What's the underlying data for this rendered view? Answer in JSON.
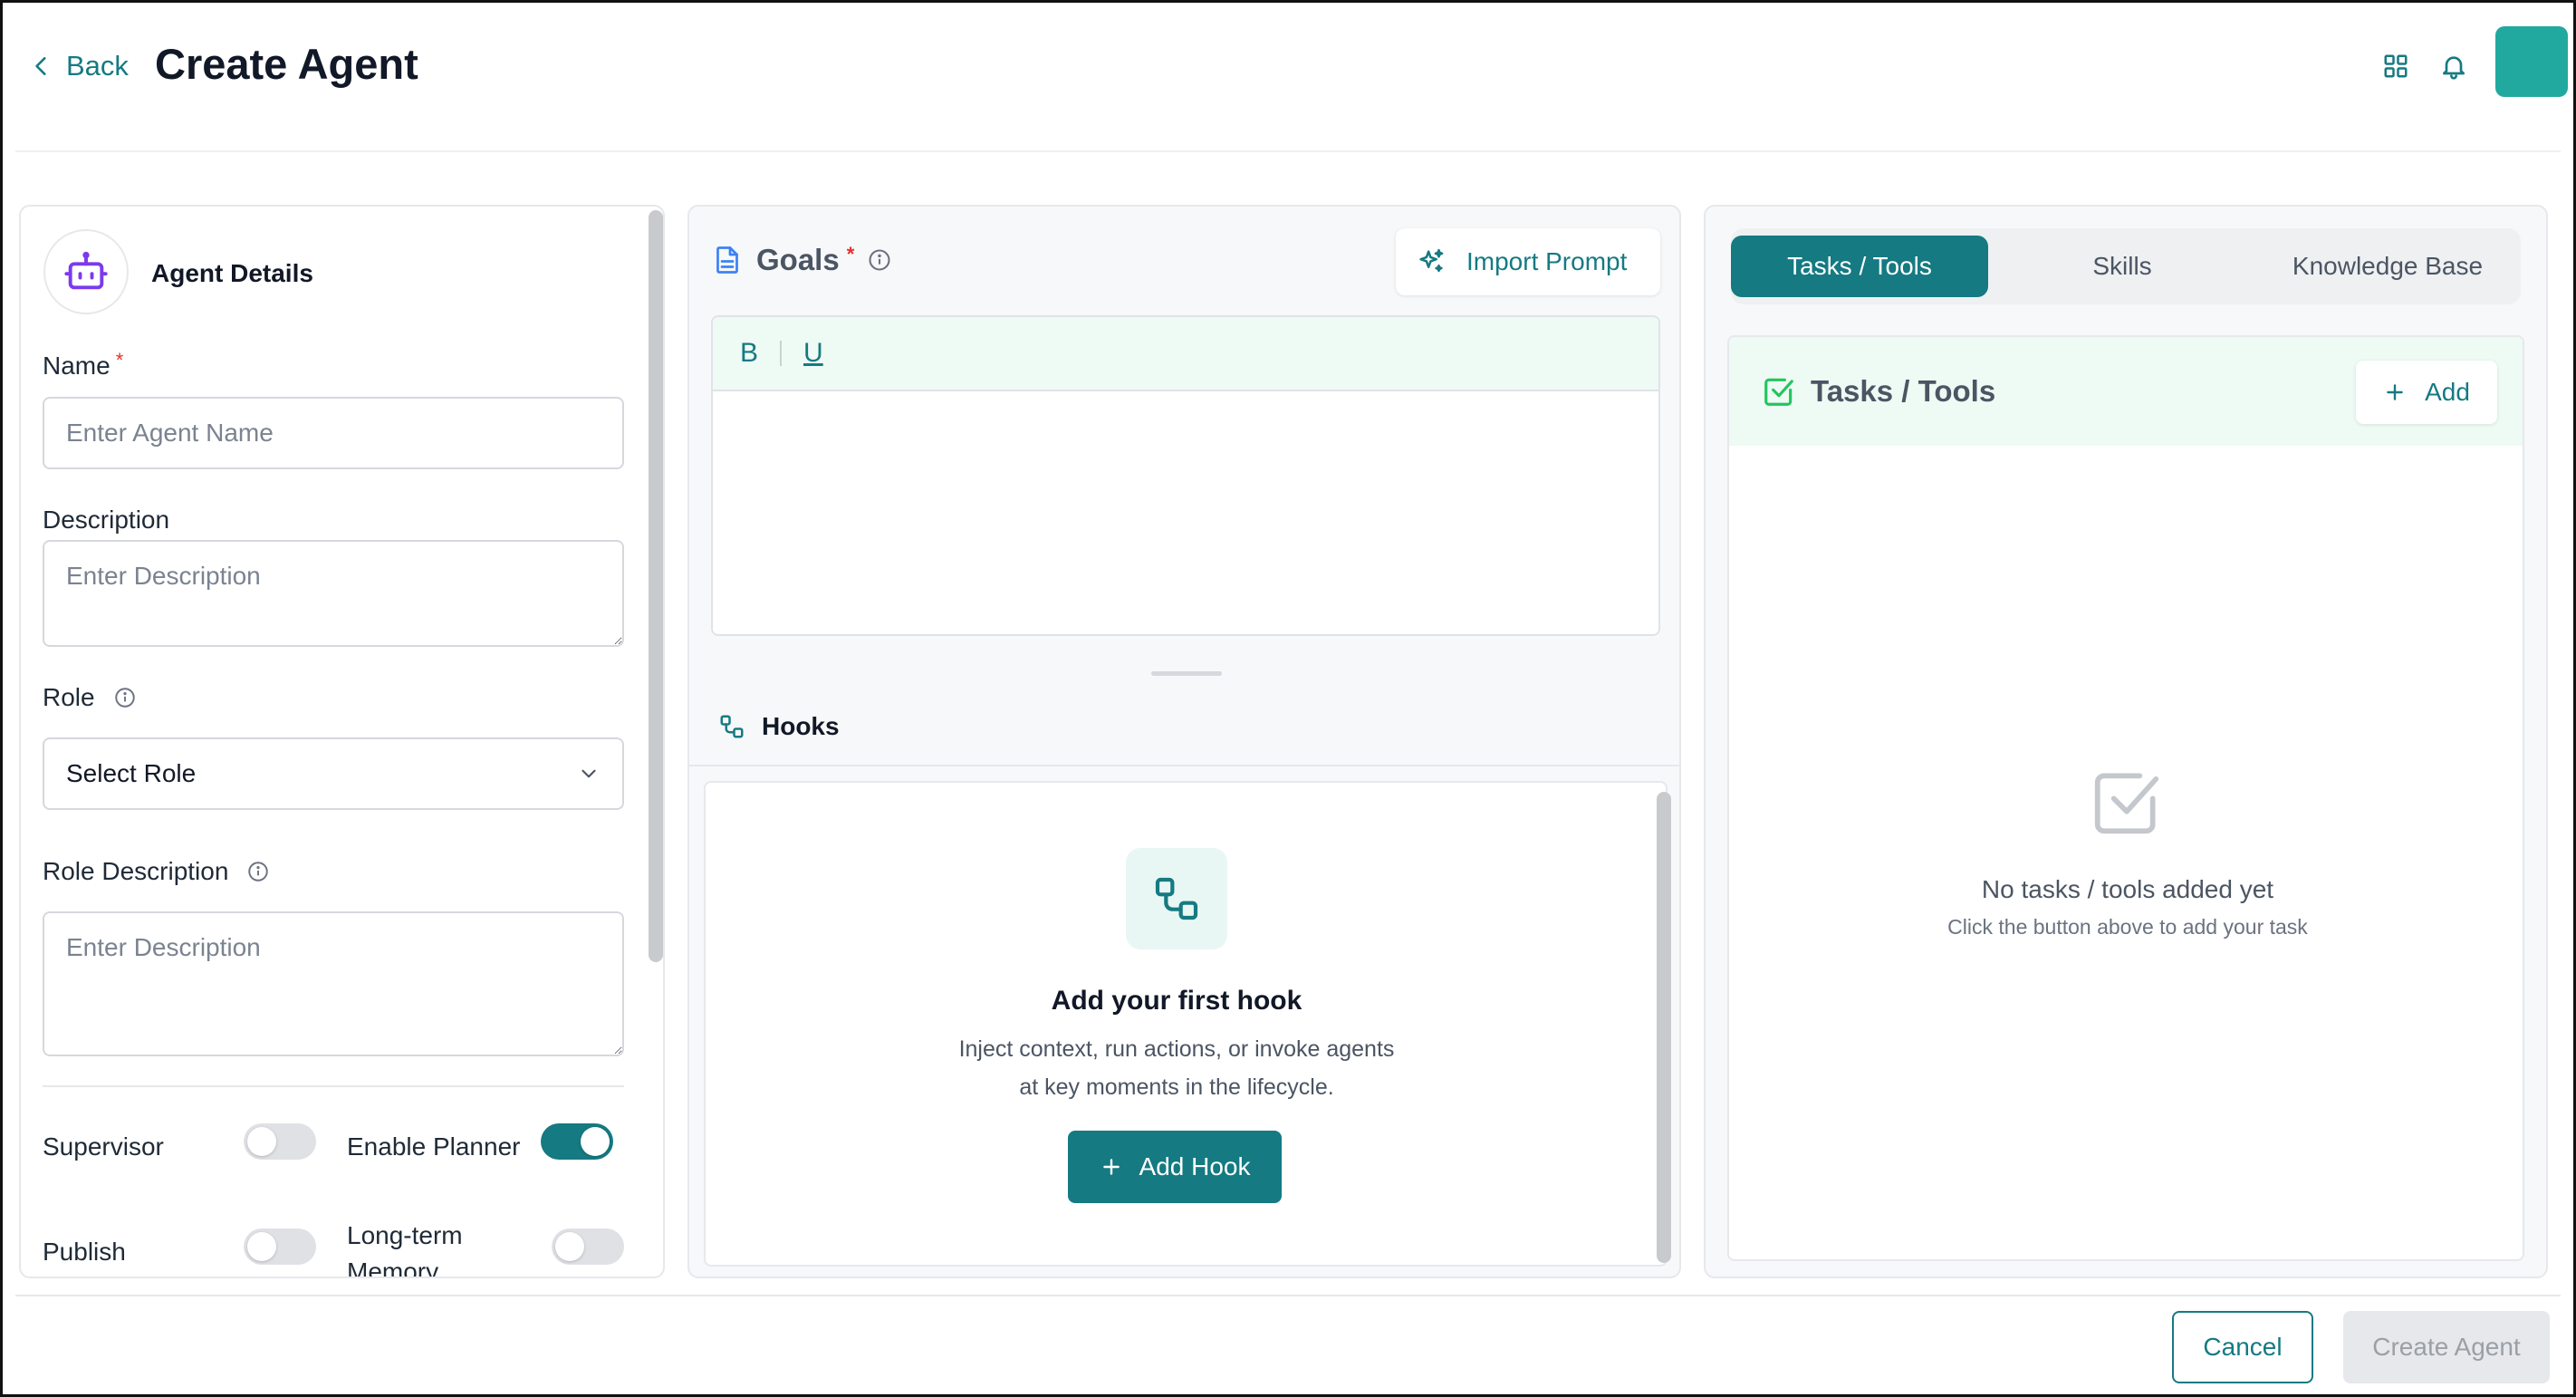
{
  "header": {
    "back_label": "Back",
    "title": "Create Agent",
    "icons": [
      "grid-icon",
      "bell-icon"
    ],
    "avatar_color": "#21a9a0"
  },
  "left": {
    "section_title": "Agent Details",
    "name_label": "Name",
    "name_placeholder": "Enter Agent Name",
    "required_mark": "*",
    "description_label": "Description",
    "description_placeholder": "Enter Description",
    "role_label": "Role",
    "role_value": "Select Role",
    "role_description_label": "Role Description",
    "role_description_placeholder": "Enter Description",
    "toggles": {
      "supervisor": {
        "label": "Supervisor",
        "on": false
      },
      "enable_planner": {
        "label": "Enable Planner",
        "on": true
      },
      "publish": {
        "label": "Publish",
        "on": false
      },
      "long_term_memory": {
        "label": "Long-term Memory",
        "on": false
      }
    }
  },
  "middle": {
    "goals_label": "Goals",
    "required_mark": "*",
    "import_prompt_label": "Import Prompt",
    "toolbar": {
      "bold": "B",
      "underline": "U"
    },
    "hooks_label": "Hooks",
    "hook_empty_title": "Add your first hook",
    "hook_empty_line1": "Inject context, run actions, or invoke agents",
    "hook_empty_line2": "at key moments in the lifecycle.",
    "add_hook_label": "Add Hook"
  },
  "right": {
    "tabs": [
      {
        "label": "Tasks / Tools",
        "active": true
      },
      {
        "label": "Skills",
        "active": false
      },
      {
        "label": "Knowledge Base",
        "active": false
      }
    ],
    "section_title": "Tasks / Tools",
    "add_label": "Add",
    "empty_title": "No tasks / tools added yet",
    "empty_subtitle": "Click the button above to add your task"
  },
  "footer": {
    "cancel_label": "Cancel",
    "create_label": "Create Agent"
  },
  "colors": {
    "accent": "#157a82",
    "accent_light": "#eefaf4",
    "required": "#e0322c",
    "disabled_bg": "#e6e8eb"
  }
}
